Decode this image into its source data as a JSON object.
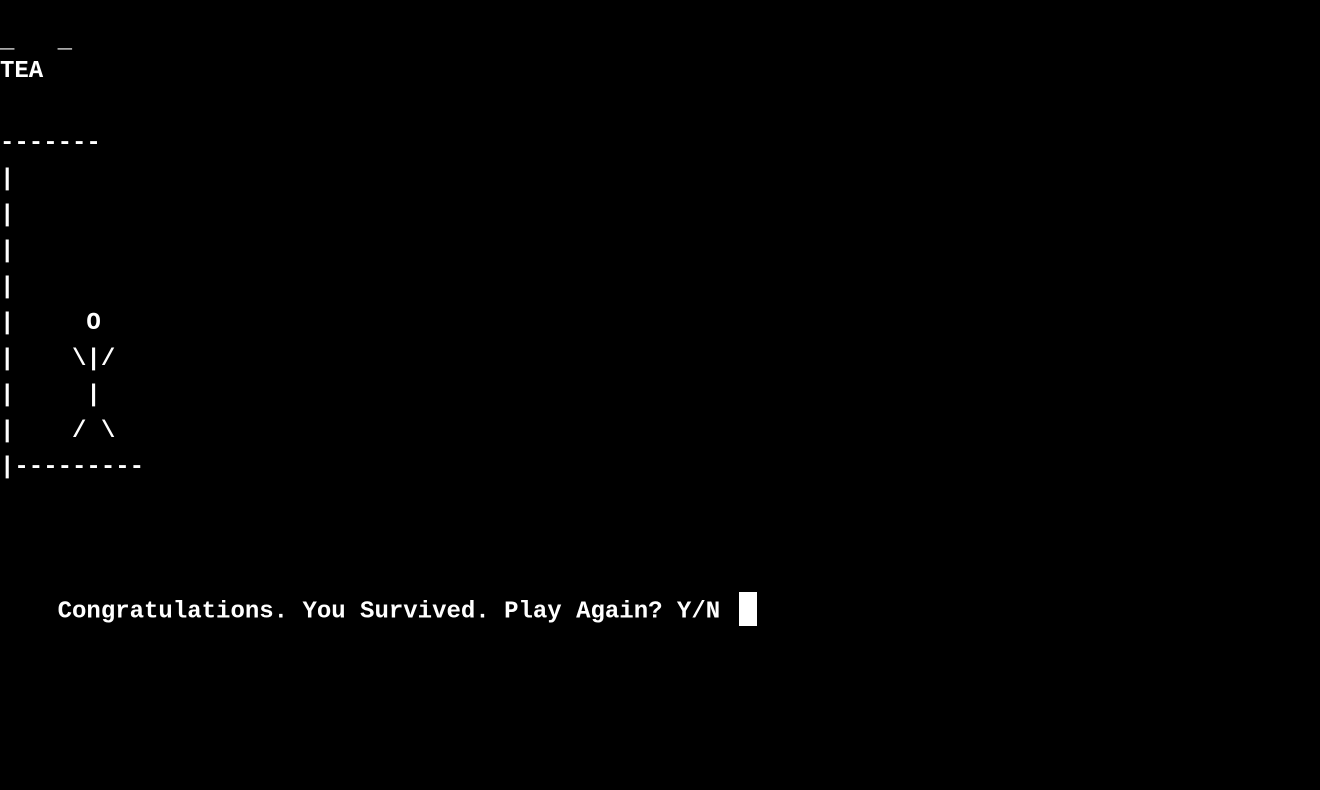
{
  "terminal": {
    "blanks": "_   _",
    "word": "TEA",
    "gallows_rows": [
      "-------",
      "|",
      "|",
      "|",
      "|",
      "|     O",
      "|    \\|/",
      "|     |",
      "|    / \\",
      "|---------"
    ],
    "message": "Congratulations. You Survived. Play Again? Y/N ",
    "colors": {
      "background": "#000000",
      "text": "#ffffff"
    }
  }
}
